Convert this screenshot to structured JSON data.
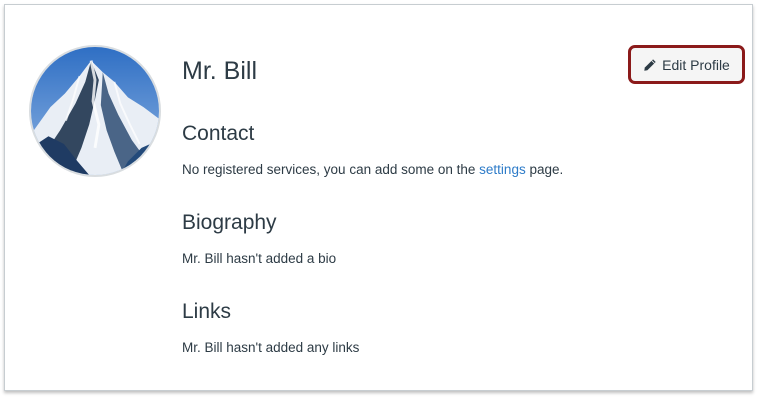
{
  "profile": {
    "name": "Mr. Bill",
    "edit_button_label": "Edit Profile",
    "edit_icon": "pencil-icon"
  },
  "contact": {
    "title": "Contact",
    "text_before": "No registered services, you can add some on the ",
    "link_text": "settings",
    "text_after": " page."
  },
  "biography": {
    "title": "Biography",
    "text": "Mr. Bill hasn't added a bio"
  },
  "links": {
    "title": "Links",
    "text": "Mr. Bill hasn't added any links"
  },
  "colors": {
    "text": "#2d3b45",
    "link": "#2d7bc8",
    "highlight_border": "#8b1a1a",
    "button_bg": "#f5f5f5"
  }
}
